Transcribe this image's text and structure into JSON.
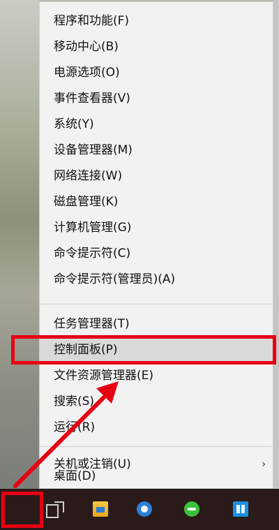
{
  "menu": {
    "items": [
      {
        "label": "程序和功能(F)"
      },
      {
        "label": "移动中心(B)"
      },
      {
        "label": "电源选项(O)"
      },
      {
        "label": "事件查看器(V)"
      },
      {
        "label": "系统(Y)"
      },
      {
        "label": "设备管理器(M)"
      },
      {
        "label": "网络连接(W)"
      },
      {
        "label": "磁盘管理(K)"
      },
      {
        "label": "计算机管理(G)"
      },
      {
        "label": "命令提示符(C)"
      },
      {
        "label": "命令提示符(管理员)(A)"
      },
      {
        "label": "任务管理器(T)"
      },
      {
        "label": "控制面板(P)"
      },
      {
        "label": "文件资源管理器(E)"
      },
      {
        "label": "搜索(S)"
      },
      {
        "label": "运行(R)"
      },
      {
        "label": "关机或注销(U)",
        "submenu_arrow": "›"
      },
      {
        "label": "桌面(D)"
      }
    ],
    "highlighted_item": "控制面板(P)"
  },
  "taskbar": {
    "icons": [
      "start-button",
      "task-view-icon",
      "file-explorer-icon",
      "browser-icon",
      "wechat-icon",
      "store-icon"
    ]
  },
  "annotation": {
    "color": "#e60012"
  }
}
